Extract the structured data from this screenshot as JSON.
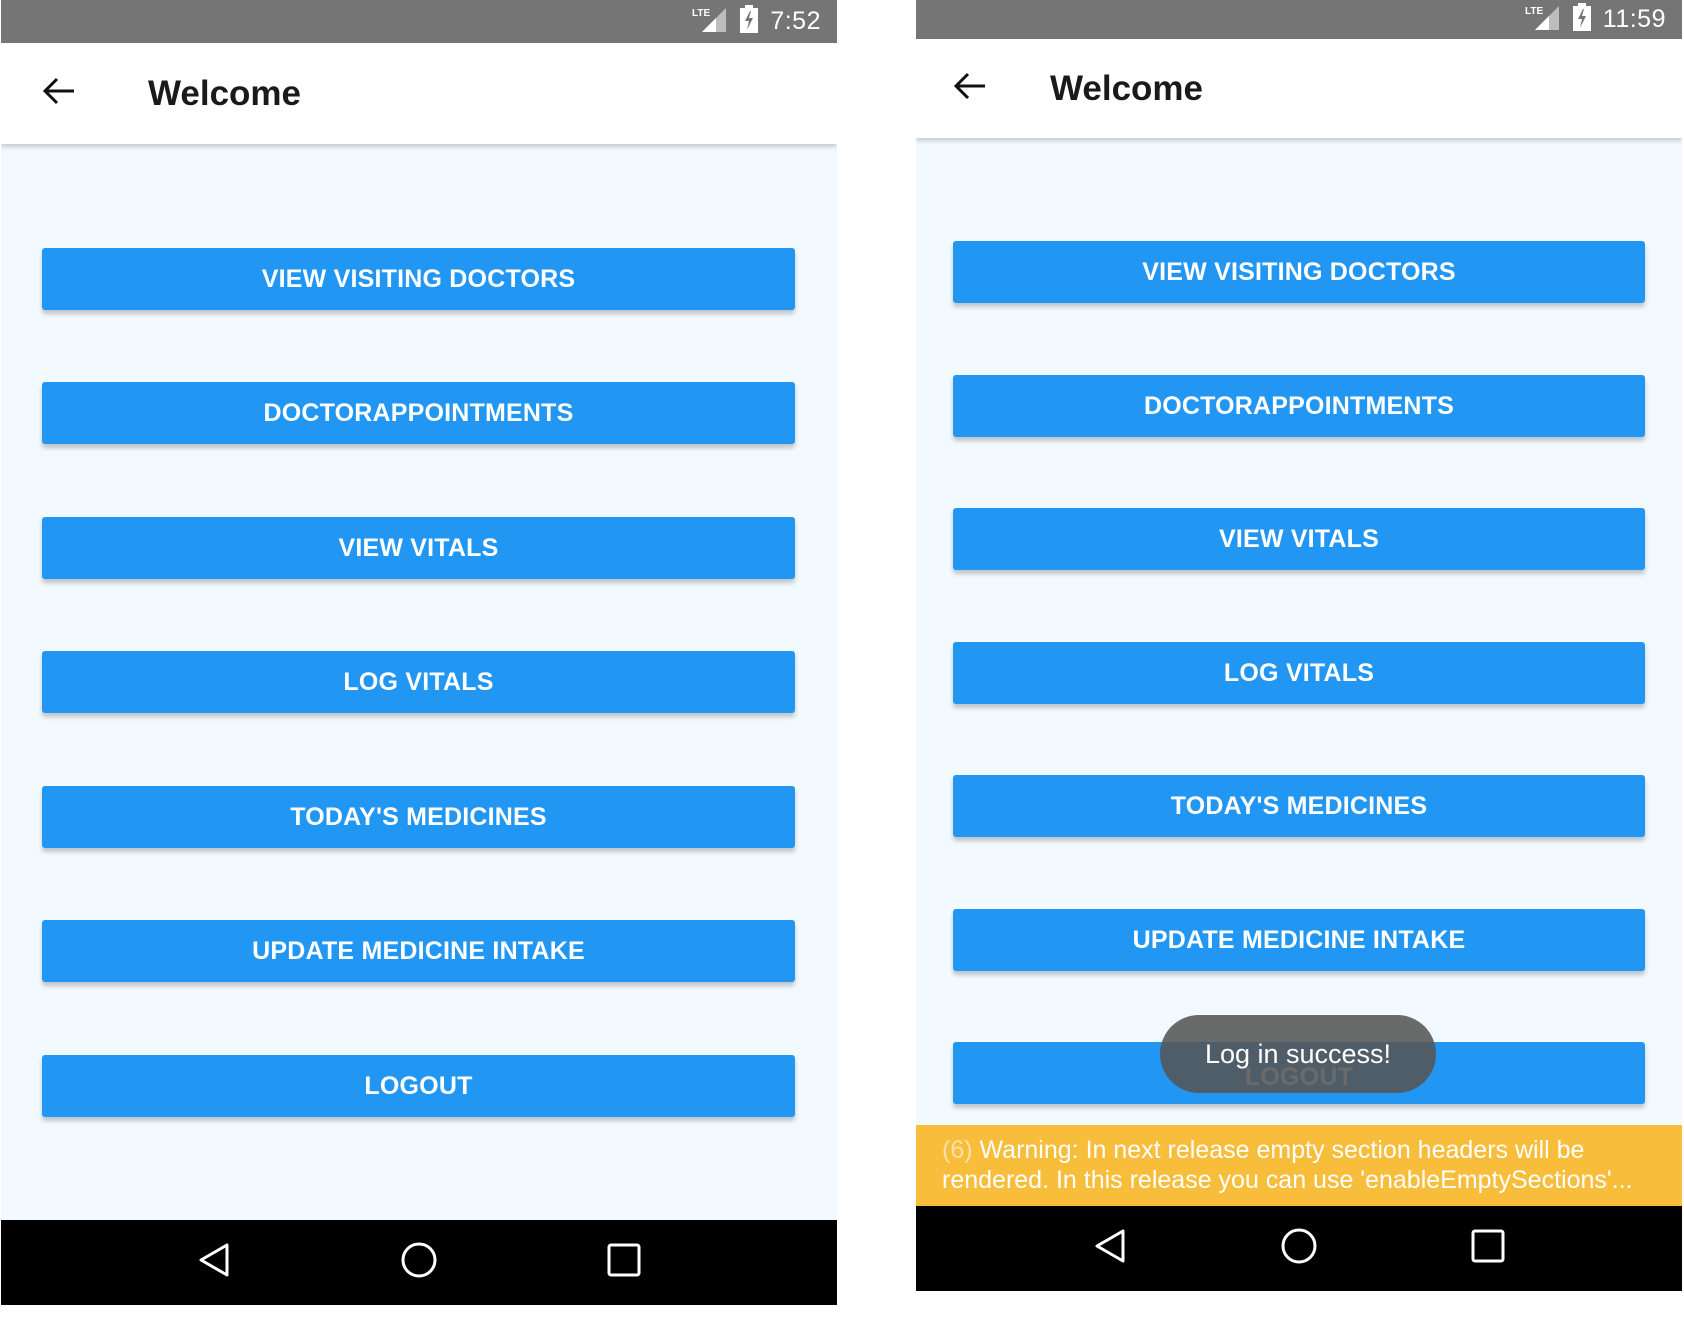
{
  "screens": [
    {
      "status": {
        "network": "LTE",
        "time": "7:52"
      },
      "app_bar": {
        "title": "Welcome"
      },
      "buttons": [
        "VIEW VISITING DOCTORS",
        "DOCTORAPPOINTMENTS",
        "VIEW VITALS",
        "LOG VITALS",
        "TODAY'S MEDICINES",
        "UPDATE MEDICINE INTAKE",
        "LOGOUT"
      ]
    },
    {
      "status": {
        "network": "LTE",
        "time": "11:59"
      },
      "app_bar": {
        "title": "Welcome"
      },
      "buttons": [
        "VIEW VISITING DOCTORS",
        "DOCTORAPPOINTMENTS",
        "VIEW VITALS",
        "LOG VITALS",
        "TODAY'S MEDICINES",
        "UPDATE MEDICINE INTAKE",
        "LOGOUT"
      ],
      "toast": "Log in success!",
      "warning": {
        "count": "(6)",
        "text": " Warning: In next release empty section headers will be rendered. In this release you can use 'enableEmptySections'..."
      }
    }
  ],
  "colors": {
    "button": "#2196f3",
    "status_bar": "#757575",
    "content_bg": "#f3faff",
    "warning": "#f8bd3a"
  }
}
